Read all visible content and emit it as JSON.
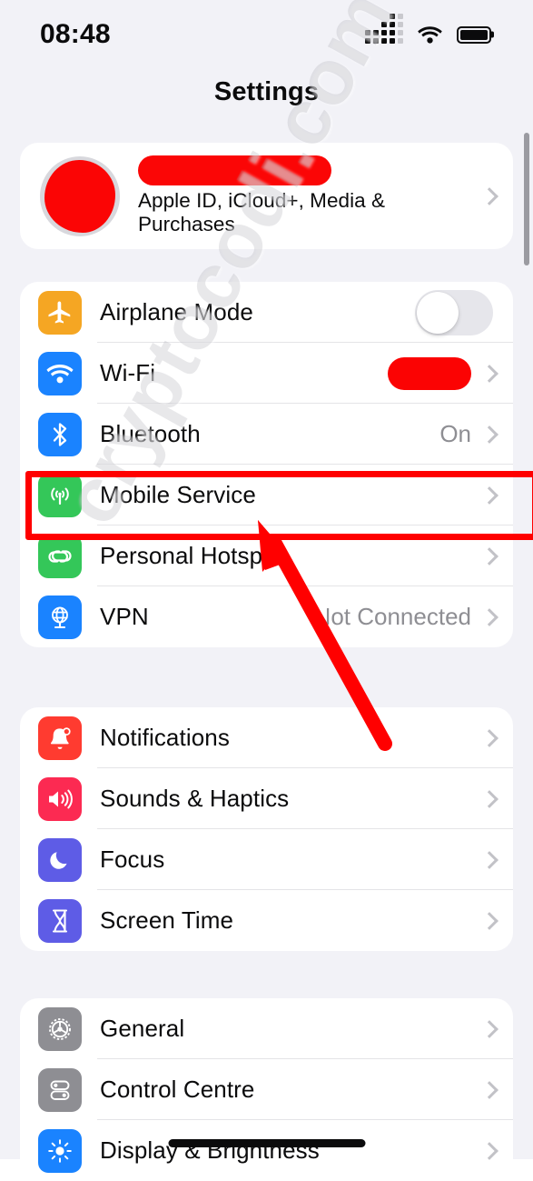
{
  "status_bar": {
    "time": "08:48",
    "signal_icon": "cellular-signal-dots-icon",
    "wifi_icon": "wifi-icon",
    "battery_icon": "battery-full-icon"
  },
  "header": {
    "title": "Settings"
  },
  "profile": {
    "avatar_icon": "avatar-redacted",
    "name": "",
    "name_redacted": true,
    "subtitle": "Apple ID, iCloud+, Media & Purchases",
    "chevron": "chevron-right-icon"
  },
  "groups": [
    {
      "name": "connectivity",
      "rows": [
        {
          "label": "Airplane Mode",
          "icon": "airplane-icon",
          "icon_color": "#F5A623",
          "control": "toggle",
          "toggle_on": false
        },
        {
          "label": "Wi-Fi",
          "icon": "wifi-icon",
          "icon_color": "#1A83FF",
          "control": "redacted-value",
          "value": "",
          "redacted": true
        },
        {
          "label": "Bluetooth",
          "icon": "bluetooth-icon",
          "icon_color": "#1A83FF",
          "control": "value",
          "value": "On"
        },
        {
          "label": "Mobile Service",
          "icon": "cellular-tower-icon",
          "icon_color": "#34C759",
          "control": "chevron",
          "value": "",
          "highlighted": true
        },
        {
          "label": "Personal Hotspot",
          "icon": "hotspot-link-icon",
          "icon_color": "#34C759",
          "control": "chevron",
          "value": ""
        },
        {
          "label": "VPN",
          "icon": "vpn-globe-icon",
          "icon_color": "#1A83FF",
          "control": "value",
          "value": "Not Connected"
        }
      ]
    },
    {
      "name": "alerts",
      "rows": [
        {
          "label": "Notifications",
          "icon": "notifications-bell-icon",
          "icon_color": "#FF3B30",
          "control": "chevron",
          "value": ""
        },
        {
          "label": "Sounds & Haptics",
          "icon": "sounds-speaker-icon",
          "icon_color": "#FC2A52",
          "control": "chevron",
          "value": ""
        },
        {
          "label": "Focus",
          "icon": "focus-moon-icon",
          "icon_color": "#5E5CE6",
          "control": "chevron",
          "value": ""
        },
        {
          "label": "Screen Time",
          "icon": "screen-time-hourglass-icon",
          "icon_color": "#5E5CE6",
          "control": "chevron",
          "value": ""
        }
      ]
    },
    {
      "name": "system",
      "rows": [
        {
          "label": "General",
          "icon": "general-gear-icon",
          "icon_color": "#8E8E93",
          "control": "chevron",
          "value": ""
        },
        {
          "label": "Control Centre",
          "icon": "control-centre-toggles-icon",
          "icon_color": "#8E8E93",
          "control": "chevron",
          "value": ""
        },
        {
          "label": "Display & Brightness",
          "icon": "display-brightness-icon",
          "icon_color": "#1A83FF",
          "control": "chevron",
          "value": ""
        }
      ]
    }
  ],
  "annotations": {
    "highlight_target": "Mobile Service",
    "highlight_color": "#FF0000",
    "arrow_color": "#FF0000",
    "arrow_points_to": "Mobile Service"
  },
  "watermark": {
    "text": "cryptocodi.com"
  },
  "colors": {
    "background": "#F2F2F7",
    "card": "#FFFFFF",
    "primary_text": "#0B0B0C",
    "secondary_text": "#8E8E93",
    "separator": "#E4E4E7",
    "redaction": "#FB0505"
  }
}
